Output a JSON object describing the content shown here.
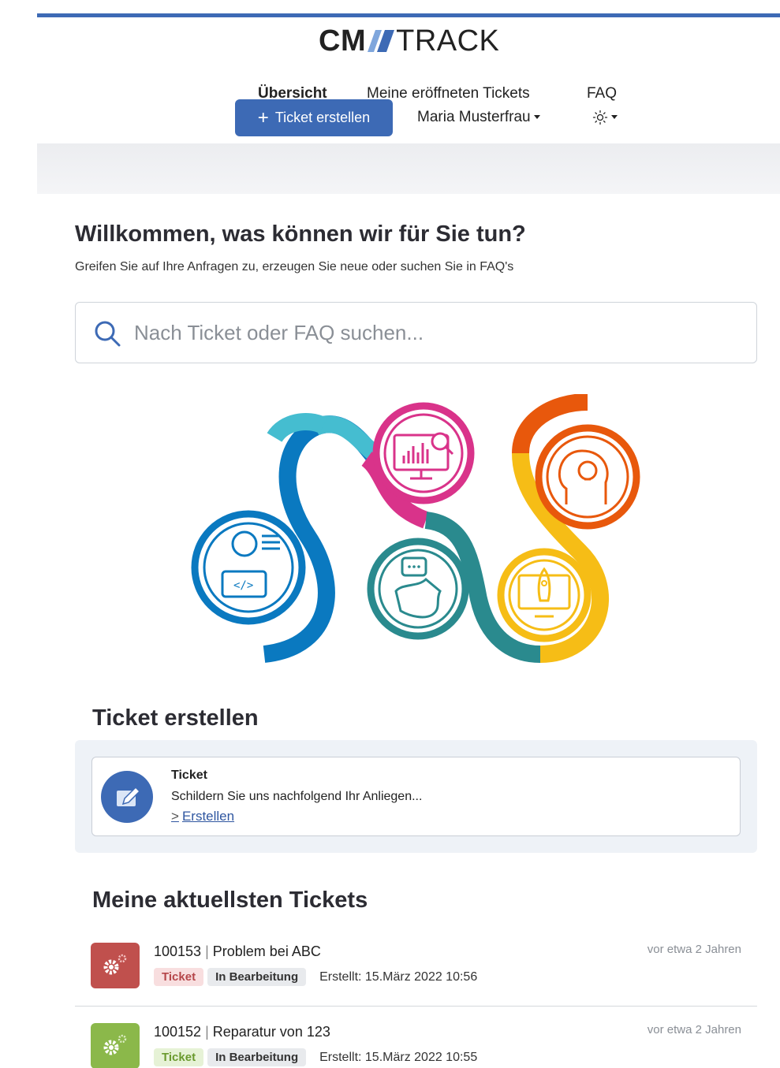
{
  "app": {
    "logo_cm": "CM",
    "logo_track": "TRACK",
    "brand_color": "#3d6ab5"
  },
  "nav": {
    "items": [
      {
        "label": "Übersicht",
        "active": true
      },
      {
        "label": "Meine eröffneten Tickets",
        "active": false
      },
      {
        "label": "FAQ",
        "active": false
      }
    ],
    "create_button": "+ Ticket erstellen",
    "create_button_label": "Ticket erstellen",
    "user_name": "Maria Musterfrau",
    "theme_icon": "sun-icon"
  },
  "welcome": {
    "title": "Willkommen, was können wir für Sie tun?",
    "subtitle": "Greifen Sie auf Ihre Anfragen zu, erzeugen Sie neue oder suchen Sie in FAQ's"
  },
  "search": {
    "placeholder": "Nach Ticket oder FAQ suchen...",
    "value": ""
  },
  "create_section": {
    "title": "Ticket erstellen",
    "card_title": "Ticket",
    "card_description": "Schildern Sie uns nachfolgend Ihr Anliegen...",
    "card_link": "Erstellen"
  },
  "tickets_section": {
    "title": "Meine aktuellsten Tickets",
    "tickets": [
      {
        "id": "100153",
        "subject": "Problem bei ABC",
        "type": "Ticket",
        "status": "In Bearbeitung",
        "created": "Erstellt: 15.März 2022 10:56",
        "age": "vor etwa 2 Jahren",
        "icon_color": "#c0504d"
      },
      {
        "id": "100152",
        "subject": "Reparatur von 123",
        "type": "Ticket",
        "status": "In Bearbeitung",
        "created": "Erstellt: 15.März 2022 10:55",
        "age": "vor etwa 2 Jahren",
        "icon_color": "#8bb84a"
      }
    ]
  }
}
